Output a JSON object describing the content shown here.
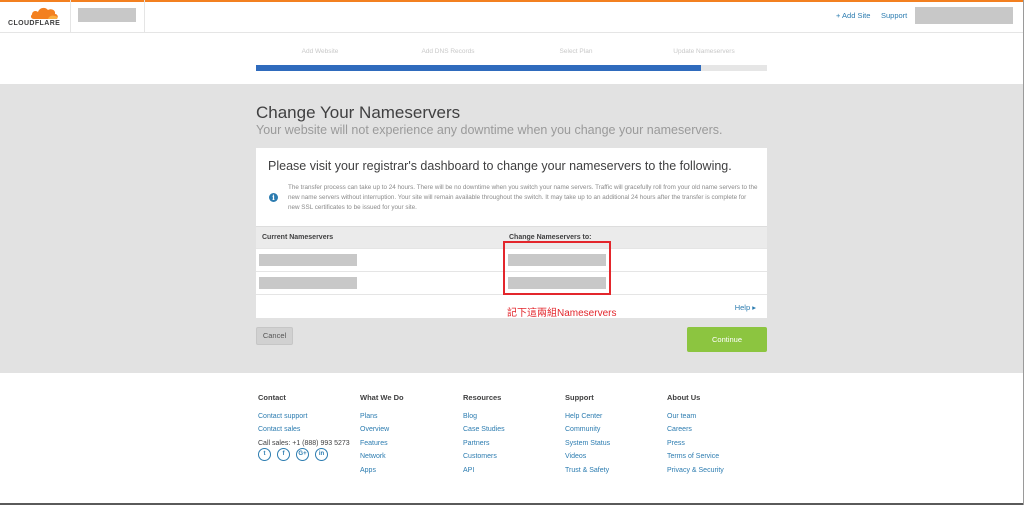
{
  "header": {
    "logo_text": "CLOUDFLARE",
    "add_site": "+ Add Site",
    "support": "Support"
  },
  "progress": {
    "steps": [
      "Add Website",
      "Add DNS Records",
      "Select Plan",
      "Update Nameservers"
    ],
    "completed_fraction": 0.87
  },
  "page": {
    "title": "Change Your Nameservers",
    "subtitle": "Your website will not experience any downtime when you change your nameservers."
  },
  "card": {
    "heading": "Please visit your registrar's dashboard to change your nameservers to the following.",
    "info_text": "The transfer process can take up to 24 hours. There will be no downtime when you switch your name servers. Traffic will gracefully roll from your old name servers to the new name servers without interruption. Your site will remain available throughout the switch. It may take up to an additional 24 hours after the transfer is complete for new SSL certificates to be issued for your site.",
    "col_current": "Current Nameservers",
    "col_change": "Change Nameservers to:",
    "help": "Help ▸"
  },
  "annotation": "記下這兩組Nameservers",
  "buttons": {
    "cancel": "Cancel",
    "continue": "Continue"
  },
  "footer": {
    "contact": {
      "heading": "Contact",
      "links": [
        "Contact support",
        "Contact sales"
      ],
      "phone": "Call sales: +1 (888) 993 5273"
    },
    "what_we_do": {
      "heading": "What We Do",
      "links": [
        "Plans",
        "Overview",
        "Features",
        "Network",
        "Apps"
      ]
    },
    "resources": {
      "heading": "Resources",
      "links": [
        "Blog",
        "Case Studies",
        "Partners",
        "Customers",
        "API"
      ]
    },
    "support": {
      "heading": "Support",
      "links": [
        "Help Center",
        "Community",
        "System Status",
        "Videos",
        "Trust & Safety"
      ]
    },
    "about": {
      "heading": "About Us",
      "links": [
        "Our team",
        "Careers",
        "Press",
        "Terms of Service",
        "Privacy & Security"
      ]
    },
    "social": [
      "t",
      "f",
      "G+",
      "in"
    ]
  },
  "colors": {
    "brand_orange": "#f38020",
    "link_blue": "#2c7cb0",
    "progress_blue": "#2f6bbd",
    "continue_green": "#8cc540",
    "annotation_red": "#e3262c"
  }
}
